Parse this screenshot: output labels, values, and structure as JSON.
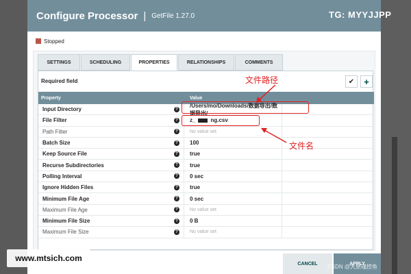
{
  "dialog": {
    "title": "Configure Processor",
    "separator": "|",
    "processor_type": "GetFile 1.27.0",
    "state": "Stopped"
  },
  "tabs": [
    {
      "label": "SETTINGS",
      "active": false
    },
    {
      "label": "SCHEDULING",
      "active": false
    },
    {
      "label": "PROPERTIES",
      "active": true
    },
    {
      "label": "RELATIONSHIPS",
      "active": false
    },
    {
      "label": "COMMENTS",
      "active": false
    }
  ],
  "properties_panel": {
    "required_field_label": "Required field",
    "verify_icon": "check-circle-icon",
    "add_icon": "plus-icon",
    "add_glyph": "+",
    "verify_glyph": "✔",
    "column_property": "Property",
    "column_value": "Value",
    "rows": [
      {
        "name": "Input Directory",
        "value": "/Users/mo/Downloads/数据导出/数据导出/",
        "required": true,
        "unset": false
      },
      {
        "name": "File Filter",
        "value_prefix": "z_",
        "value_suffix": "ng.csv",
        "required": true,
        "unset": false
      },
      {
        "name": "Path Filter",
        "value": "No value set",
        "required": false,
        "unset": true
      },
      {
        "name": "Batch Size",
        "value": "100",
        "required": true,
        "unset": false
      },
      {
        "name": "Keep Source File",
        "value": "true",
        "required": true,
        "unset": false
      },
      {
        "name": "Recurse Subdirectories",
        "value": "true",
        "required": true,
        "unset": false
      },
      {
        "name": "Polling Interval",
        "value": "0 sec",
        "required": true,
        "unset": false
      },
      {
        "name": "Ignore Hidden Files",
        "value": "true",
        "required": true,
        "unset": false
      },
      {
        "name": "Minimum File Age",
        "value": "0 sec",
        "required": true,
        "unset": false
      },
      {
        "name": "Maximum File Age",
        "value": "No value set",
        "required": false,
        "unset": true
      },
      {
        "name": "Minimum File Size",
        "value": "0 B",
        "required": true,
        "unset": false
      },
      {
        "name": "Maximum File Size",
        "value": "No value set",
        "required": false,
        "unset": true
      }
    ],
    "help_glyph": "?"
  },
  "footer": {
    "cancel_label": "CANCEL",
    "apply_label": "APPLY"
  },
  "annotations": {
    "path_label": "文件路径",
    "name_label": "文件名"
  },
  "watermarks": {
    "top": "TG: MYYJJPP",
    "bottom": "www.mtsich.com",
    "csdn": "CSDN @大原魂捞鱼"
  },
  "colors": {
    "header": "#728e9b",
    "annotation": "#e02020",
    "stopped": "#ba554a",
    "accent": "#004849"
  }
}
